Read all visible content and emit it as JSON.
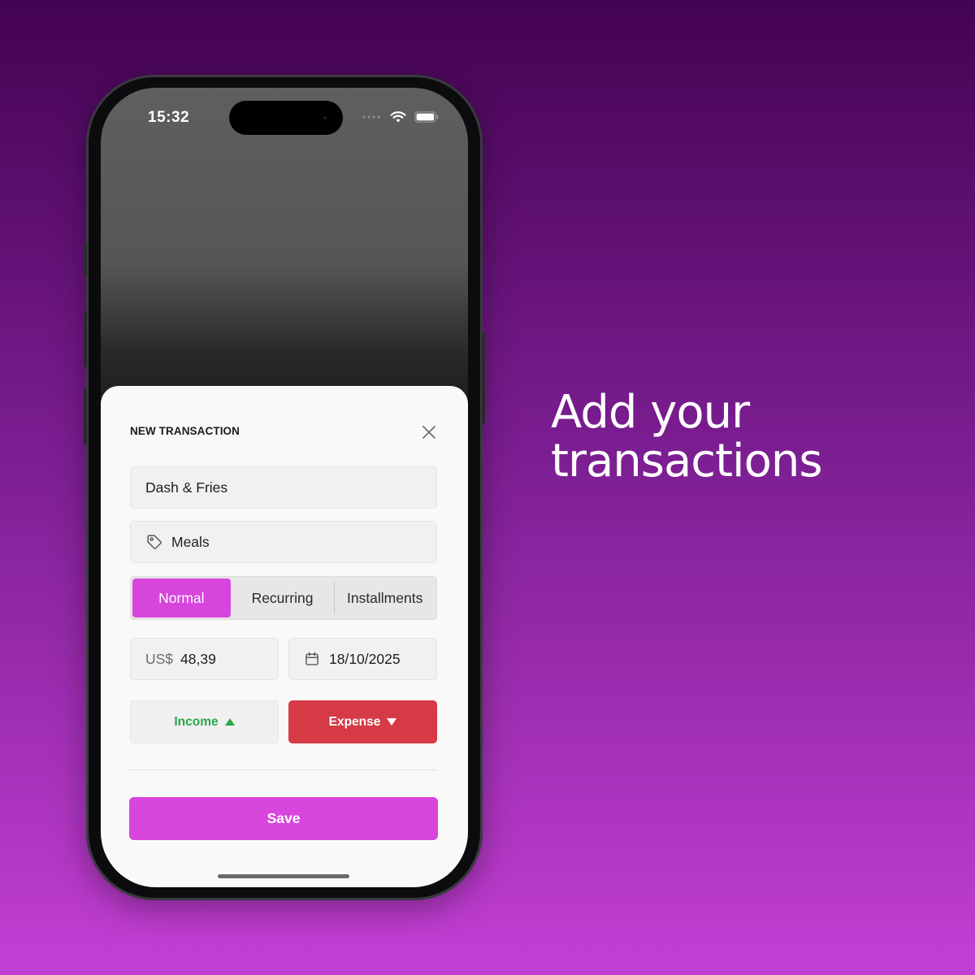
{
  "headline": {
    "line1": "Add your",
    "line2": "transactions"
  },
  "status_bar": {
    "time": "15:32"
  },
  "sheet": {
    "title": "NEW TRANSACTION",
    "description_value": "Dash & Fries",
    "category_value": "Meals",
    "category_icon": "tag-icon",
    "modes": [
      "Normal",
      "Recurring",
      "Installments"
    ],
    "selected_mode": "Normal",
    "currency": "US$",
    "amount": "48,39",
    "date": "18/10/2025",
    "income_label": "Income",
    "expense_label": "Expense",
    "selected_type": "Expense",
    "save_label": "Save"
  },
  "colors": {
    "accent": "#d845dd",
    "expense": "#d63a46",
    "income_text": "#2aa84a",
    "sheet_bg": "#f9faf8"
  }
}
